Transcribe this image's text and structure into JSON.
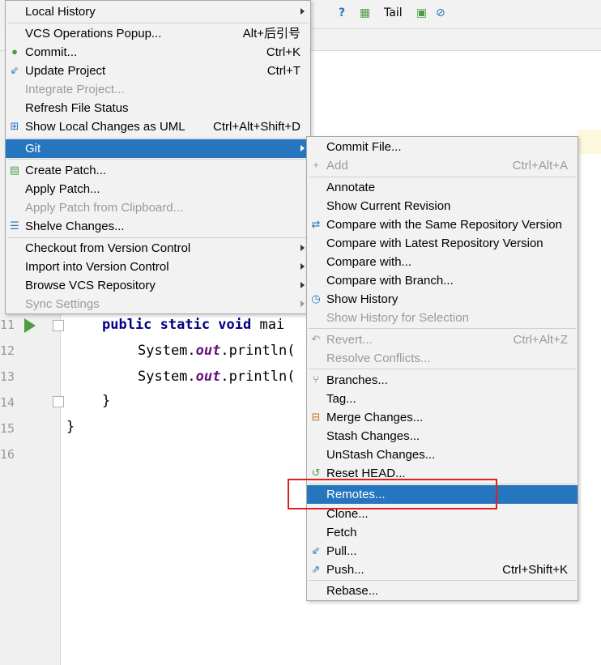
{
  "colors": {
    "selection": "#2675bf",
    "disabled": "#9a9a9a",
    "keyword": "#000080",
    "static_field": "#660e7a",
    "annotation_box": "#e02020"
  },
  "toolbar": {
    "tail_label": "Tail"
  },
  "editor": {
    "line_numbers": [
      "11",
      "12",
      "13",
      "14",
      "15",
      "16"
    ],
    "lines": [
      {
        "kw": "public static void",
        "rest": " mai"
      },
      {
        "pre": "System.",
        "field": "out",
        "post": ".println("
      },
      {
        "pre": "System.",
        "field": "out",
        "post": ".println("
      },
      {
        "text": "}"
      },
      {
        "text": "}"
      }
    ]
  },
  "vcs_menu": {
    "items": [
      {
        "label": "Local History",
        "submenu": true
      },
      {
        "label": "VCS Operations Popup...",
        "shortcut": "Alt+后引号"
      },
      {
        "label": "Commit...",
        "shortcut": "Ctrl+K",
        "icon": "commit-icon"
      },
      {
        "label": "Update Project",
        "shortcut": "Ctrl+T",
        "icon": "update-icon"
      },
      {
        "label": "Integrate Project...",
        "disabled": true
      },
      {
        "label": "Refresh File Status"
      },
      {
        "label": "Show Local Changes as UML",
        "shortcut": "Ctrl+Alt+Shift+D",
        "icon": "uml-icon"
      },
      {
        "label": "Git",
        "submenu": true,
        "selected": true
      },
      {
        "label": "Create Patch...",
        "icon": "patch-icon"
      },
      {
        "label": "Apply Patch..."
      },
      {
        "label": "Apply Patch from Clipboard...",
        "disabled": true
      },
      {
        "label": "Shelve Changes...",
        "icon": "shelve-icon"
      },
      {
        "label": "Checkout from Version Control",
        "submenu": true
      },
      {
        "label": "Import into Version Control",
        "submenu": true
      },
      {
        "label": "Browse VCS Repository",
        "submenu": true
      },
      {
        "label": "Sync Settings",
        "submenu": true,
        "disabled": true
      }
    ]
  },
  "git_menu": {
    "items": [
      {
        "label": "Commit File..."
      },
      {
        "label": "Add",
        "shortcut": "Ctrl+Alt+A",
        "disabled": true,
        "icon": "add-icon"
      },
      {
        "label": "Annotate"
      },
      {
        "label": "Show Current Revision"
      },
      {
        "label": "Compare with the Same Repository Version",
        "icon": "compare-icon"
      },
      {
        "label": "Compare with Latest Repository Version"
      },
      {
        "label": "Compare with..."
      },
      {
        "label": "Compare with Branch..."
      },
      {
        "label": "Show History",
        "icon": "history-icon"
      },
      {
        "label": "Show History for Selection",
        "disabled": true
      },
      {
        "label": "Revert...",
        "shortcut": "Ctrl+Alt+Z",
        "disabled": true,
        "icon": "revert-icon"
      },
      {
        "label": "Resolve Conflicts...",
        "disabled": true
      },
      {
        "label": "Branches...",
        "icon": "branch-icon"
      },
      {
        "label": "Tag..."
      },
      {
        "label": "Merge Changes...",
        "icon": "merge-icon"
      },
      {
        "label": "Stash Changes..."
      },
      {
        "label": "UnStash Changes..."
      },
      {
        "label": "Reset HEAD...",
        "icon": "reset-icon"
      },
      {
        "label": "Remotes...",
        "selected": true
      },
      {
        "label": "Clone..."
      },
      {
        "label": "Fetch"
      },
      {
        "label": "Pull...",
        "icon": "pull-icon"
      },
      {
        "label": "Push...",
        "shortcut": "Ctrl+Shift+K",
        "icon": "push-icon"
      },
      {
        "label": "Rebase..."
      }
    ]
  }
}
